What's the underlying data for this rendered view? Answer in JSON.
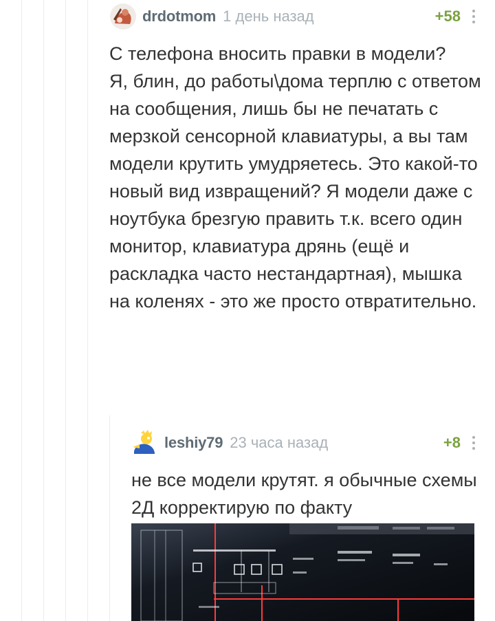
{
  "comments": [
    {
      "author": "drdotmom",
      "time": "1 день назад",
      "rating": "+58",
      "text": "С телефона вносить правки в модели?\nЯ, блин, до работы\\дома терплю с ответом на сообщения, лишь бы не печатать с мерзкой сенсорной клавиатуры, а вы там модели крутить умудряетесь. Это какой-то новый вид извращений? Я модели даже с ноутбука брезгую править т.к. всего один монитор, клавиатура дрянь (ещё и раскладка часто нестандартная), мышка на коленях - это же просто отвратительно."
    },
    {
      "author": "leshiy79",
      "time": "23 часа назад",
      "rating": "+8",
      "text": "не все модели крутят. я обычные схемы 2Д корректирую по факту"
    }
  ],
  "colors": {
    "author": "#5f6b74",
    "time": "#a9b1b7",
    "rating": "#7aa23f",
    "text": "#333333",
    "thread_line": "#e9ecef",
    "image_bg": "#0c0f14",
    "cad_red": "#ff3b3b"
  },
  "icons": {
    "menu": "vertical-dots-icon"
  }
}
